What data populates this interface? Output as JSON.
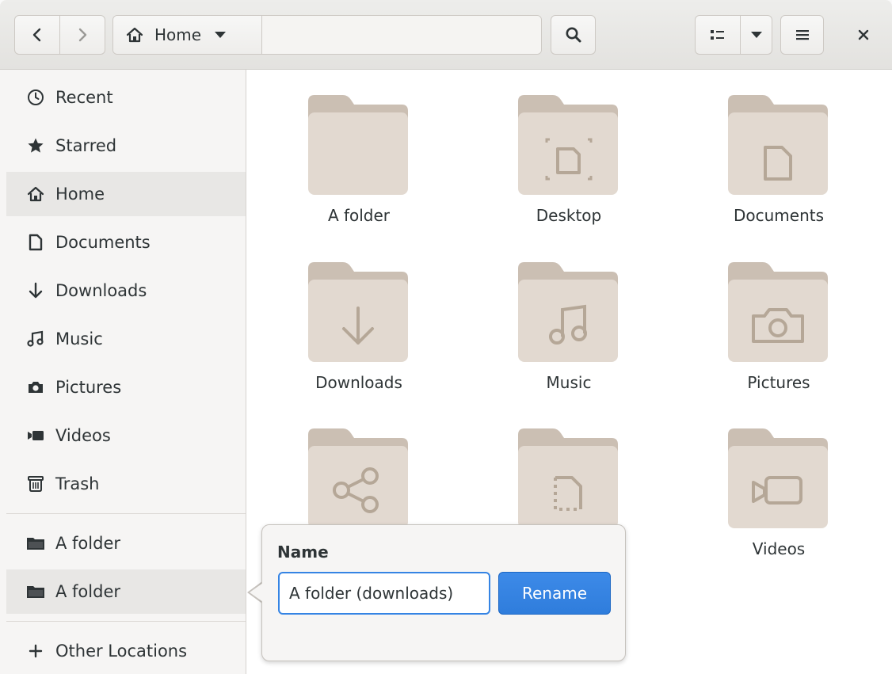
{
  "toolbar": {
    "path": {
      "home_label": "Home"
    }
  },
  "sidebar": {
    "items": [
      {
        "label": "Recent",
        "icon": "clock-icon"
      },
      {
        "label": "Starred",
        "icon": "star-icon"
      },
      {
        "label": "Home",
        "icon": "home-icon",
        "selected": true
      },
      {
        "label": "Documents",
        "icon": "document-icon"
      },
      {
        "label": "Downloads",
        "icon": "download-icon"
      },
      {
        "label": "Music",
        "icon": "music-icon"
      },
      {
        "label": "Pictures",
        "icon": "camera-icon"
      },
      {
        "label": "Videos",
        "icon": "video-icon"
      },
      {
        "label": "Trash",
        "icon": "trash-icon"
      }
    ],
    "bookmarks": [
      {
        "label": "A folder",
        "icon": "folder-icon"
      },
      {
        "label": "A folder",
        "icon": "folder-icon"
      }
    ],
    "other_locations": {
      "label": "Other Locations",
      "icon": "plus-icon"
    }
  },
  "files": [
    {
      "label": "A folder",
      "emblem": "none"
    },
    {
      "label": "Desktop",
      "emblem": "desktop"
    },
    {
      "label": "Documents",
      "emblem": "document"
    },
    {
      "label": "Downloads",
      "emblem": "download"
    },
    {
      "label": "Music",
      "emblem": "music"
    },
    {
      "label": "Pictures",
      "emblem": "camera"
    },
    {
      "label": "",
      "emblem": "share"
    },
    {
      "label": "",
      "emblem": "template"
    },
    {
      "label": "Videos",
      "emblem": "video"
    }
  ],
  "rename_popover": {
    "title": "Name",
    "value": "A folder (downloads)",
    "button_label": "Rename"
  },
  "colors": {
    "accent": "#3584e4",
    "folder_tab": "#cbbfb3",
    "folder_body": "#e2d9d0",
    "folder_emblem": "#b5a797"
  }
}
